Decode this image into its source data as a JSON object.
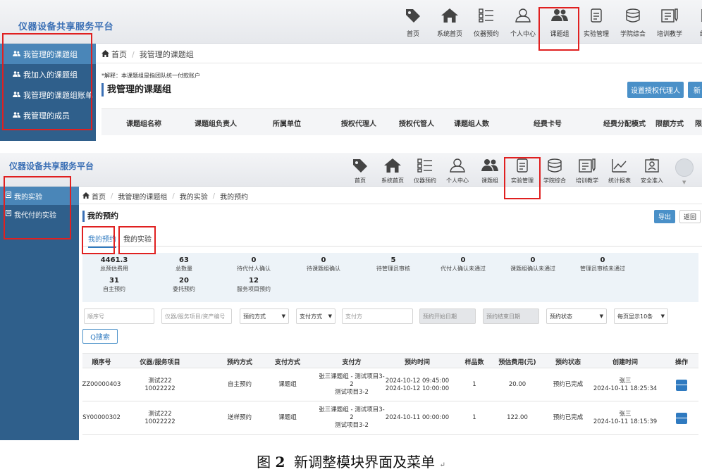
{
  "panel1": {
    "logo": "仪器设备共享服务平台",
    "nav": [
      {
        "label": "首页",
        "icon": "tag-icon"
      },
      {
        "label": "系统首页",
        "icon": "home-icon"
      },
      {
        "label": "仪器预约",
        "icon": "list-icon"
      },
      {
        "label": "个人中心",
        "icon": "user-icon"
      },
      {
        "label": "课题组",
        "icon": "group-icon"
      },
      {
        "label": "实验管理",
        "icon": "document-icon"
      },
      {
        "label": "学院综合",
        "icon": "database-icon"
      },
      {
        "label": "培训教学",
        "icon": "book-icon"
      },
      {
        "label": "统计",
        "icon": "chart-icon"
      }
    ],
    "sidebar": [
      "我管理的课题组",
      "我加入的课题组",
      "我管理的课题组账单",
      "我管理的成员"
    ],
    "breadcrumb": [
      "首页",
      "我管理的课题组"
    ],
    "note": "*解释：本课题组是指团队统一付款账户",
    "title": "我管理的课题组",
    "btn_auth": "设置授权代理人",
    "btn_new": "新",
    "columns": [
      "课题组名称",
      "课题组负责人",
      "所属单位",
      "授权代理人",
      "授权代管人",
      "课题组人数",
      "经费卡号",
      "经费分配模式",
      "限额方式",
      "限"
    ]
  },
  "panel2": {
    "logo": "仪器设备共享服务平台",
    "nav": [
      {
        "label": "首页",
        "icon": "tag-icon"
      },
      {
        "label": "系统首页",
        "icon": "home-icon"
      },
      {
        "label": "仪器预约",
        "icon": "list-icon"
      },
      {
        "label": "个人中心",
        "icon": "user-icon"
      },
      {
        "label": "课题组",
        "icon": "group-icon"
      },
      {
        "label": "实验管理",
        "icon": "document-icon"
      },
      {
        "label": "学院综合",
        "icon": "database-icon"
      },
      {
        "label": "培训教学",
        "icon": "book-icon"
      },
      {
        "label": "统计报表",
        "icon": "line-chart-icon"
      },
      {
        "label": "安全准入",
        "icon": "badge-icon"
      }
    ],
    "sidebar": [
      "我的实验",
      "我代付的实验"
    ],
    "breadcrumb": [
      "首页",
      "我管理的课题组",
      "我的实验",
      "我的预约"
    ],
    "title": "我的预约",
    "btn_export": "导出",
    "btn_back": "返回",
    "tabs": [
      "我的预约",
      "我的实验"
    ],
    "stats_row1": [
      {
        "value": "4461.3",
        "label": "总预估费用"
      },
      {
        "value": "63",
        "label": "总数量"
      },
      {
        "value": "0",
        "label": "待代付人确认"
      },
      {
        "value": "0",
        "label": "待课题组确认"
      },
      {
        "value": "5",
        "label": "待管理员审核"
      },
      {
        "value": "0",
        "label": "代付人确认未通过"
      },
      {
        "value": "0",
        "label": "课题组确认未通过"
      },
      {
        "value": "0",
        "label": "管理员审核未通过"
      }
    ],
    "stats_row2": [
      {
        "value": "31",
        "label": "自主预约"
      },
      {
        "value": "20",
        "label": "委托预约"
      },
      {
        "value": "12",
        "label": "服务项目预约"
      }
    ],
    "filters": {
      "seq_placeholder": "顺序号",
      "instrument_placeholder": "仪器/服务项目/资产编号",
      "booking_mode": "预约方式",
      "pay_mode": "支付方式",
      "payer_placeholder": "支付方",
      "start_date": "预约开始日期",
      "end_date": "预约结束日期",
      "status": "预约状态",
      "page_size": "每页显示10条"
    },
    "search_btn": "Q搜索",
    "columns": [
      "顺序号",
      "仪器/服务项目",
      "预约方式",
      "支付方式",
      "支付方",
      "预约时间",
      "样品数",
      "预估费用(元)",
      "预约状态",
      "创建时间",
      "操作"
    ],
    "rows": [
      {
        "seq": "ZZ00000403",
        "instrument": [
          "测试222",
          "10022222"
        ],
        "mode": "自主预约",
        "pay": "课题组",
        "payer": [
          "张三课题组 - 测试项目3-",
          "2",
          "测试项目3-2"
        ],
        "time": [
          "2024-10-12 09:45:00",
          "2024-10-12 10:00:00"
        ],
        "samples": "1",
        "cost": "20.00",
        "status": "预约已完成",
        "created": [
          "张三",
          "2024-10-11 18:25:34"
        ]
      },
      {
        "seq": "SY00000302",
        "instrument": [
          "测试222",
          "10022222"
        ],
        "mode": "送样预约",
        "pay": "课题组",
        "payer": [
          "张三课题组 - 测试项目3-",
          "2",
          "测试项目3-2"
        ],
        "time": [
          "2024-10-11 00:00:00"
        ],
        "samples": "1",
        "cost": "122.00",
        "status": "预约已完成",
        "created": [
          "张三",
          "2024-10-11 18:15:39"
        ]
      }
    ]
  },
  "caption": {
    "prefix": "图",
    "number": "2",
    "text": "新调整模块界面及菜单",
    "mark": "↵"
  }
}
